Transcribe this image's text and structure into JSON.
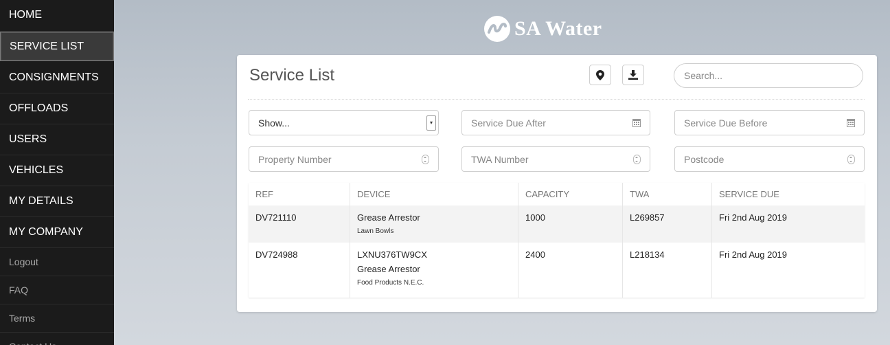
{
  "sidebar": {
    "items": [
      {
        "label": "HOME"
      },
      {
        "label": "SERVICE LIST"
      },
      {
        "label": "CONSIGNMENTS"
      },
      {
        "label": "OFFLOADS"
      },
      {
        "label": "USERS"
      },
      {
        "label": "VEHICLES"
      },
      {
        "label": "MY DETAILS"
      },
      {
        "label": "MY COMPANY"
      },
      {
        "label": "Logout"
      },
      {
        "label": "FAQ"
      },
      {
        "label": "Terms"
      },
      {
        "label": "Contact Us"
      }
    ],
    "active": "SERVICE LIST"
  },
  "brand": {
    "name": "SA Water"
  },
  "panel": {
    "title": "Service List",
    "icons": {
      "location": "map-marker-icon",
      "download": "download-icon"
    },
    "search": {
      "placeholder": "Search..."
    },
    "filters": {
      "show": "Show...",
      "due_after": "Service Due After",
      "due_before": "Service Due Before",
      "property_number": "Property Number",
      "twa_number": "TWA Number",
      "postcode": "Postcode"
    }
  },
  "table": {
    "headers": [
      "REF",
      "DEVICE",
      "CAPACITY",
      "TWA",
      "SERVICE DUE"
    ],
    "rows": [
      {
        "ref": "DV721110",
        "device_id": "",
        "device": "Grease Arrestor",
        "device_sub": "Lawn Bowls",
        "capacity": "1000",
        "twa": "L269857",
        "service_due": "Fri 2nd Aug 2019"
      },
      {
        "ref": "DV724988",
        "device_id": "LXNU376TW9CX",
        "device": "Grease Arrestor",
        "device_sub": "Food Products N.E.C.",
        "capacity": "2400",
        "twa": "L218134",
        "service_due": "Fri 2nd Aug 2019"
      }
    ]
  },
  "colors": {
    "sidebar_bg": "#1b1b1b",
    "background": "#c4cbd3",
    "panel_bg": "#ffffff",
    "row_alt": "#f3f3f3"
  }
}
